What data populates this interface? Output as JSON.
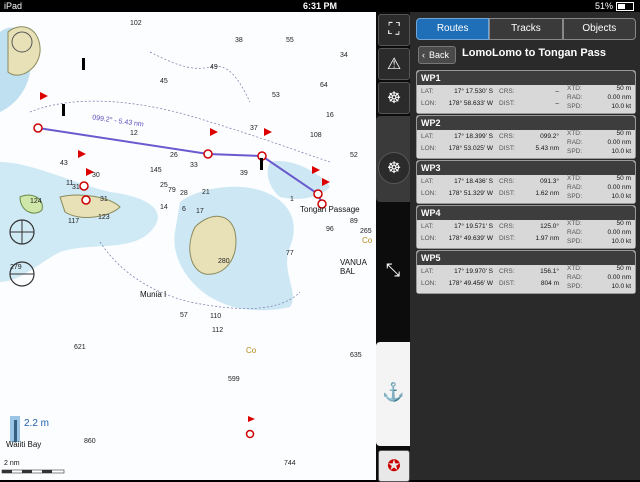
{
  "status": {
    "device": "iPad",
    "time": "6:31 PM",
    "battery": "51%"
  },
  "tabs": [
    {
      "label": "Routes",
      "active": true
    },
    {
      "label": "Tracks",
      "active": false
    },
    {
      "label": "Objects",
      "active": false
    }
  ],
  "back_label": "Back",
  "route_title": "LomoLomo to Tongan Pass",
  "waypoints": [
    {
      "name": "WP1",
      "lat": "17° 17.530' S",
      "lon": "178° 58.633' W",
      "crs": "–",
      "dist": "–",
      "xtd": "50 m",
      "rad": "0.00 nm",
      "spd": "10.0 kt"
    },
    {
      "name": "WP2",
      "lat": "17° 18.399' S",
      "lon": "178° 53.025' W",
      "crs": "099.2°",
      "dist": "5.43 nm",
      "xtd": "50 m",
      "rad": "0.00 nm",
      "spd": "10.0 kt"
    },
    {
      "name": "WP3",
      "lat": "17° 18.436' S",
      "lon": "178° 51.329' W",
      "crs": "091.3°",
      "dist": "1.62 nm",
      "xtd": "50 m",
      "rad": "0.00 nm",
      "spd": "10.0 kt"
    },
    {
      "name": "WP4",
      "lat": "17° 19.571' S",
      "lon": "178° 49.639' W",
      "crs": "125.0°",
      "dist": "1.97 nm",
      "xtd": "50 m",
      "rad": "0.00 nm",
      "spd": "10.0 kt"
    },
    {
      "name": "WP5",
      "lat": "17° 19.970' S",
      "lon": "178° 49.456' W",
      "crs": "156.1°",
      "dist": "804 m",
      "xtd": "50 m",
      "rad": "0.00 nm",
      "spd": "10.0 kt"
    }
  ],
  "field_labels": {
    "lat": "LAT:",
    "lon": "LON:",
    "crs": "CRS:",
    "dist": "DIST:",
    "xtd": "XTD:",
    "rad": "RAD:",
    "spd": "SPD:"
  },
  "map": {
    "place_labels": [
      "Tongan Passage",
      "VANUA BAL",
      "Munia I",
      "Waiiti Bay"
    ],
    "leg_label": "099.2° - 5.43 nm",
    "scale": "2 nm",
    "tide_height": "2.2 m",
    "soundings": [
      "55",
      "49",
      "45",
      "53",
      "64",
      "16",
      "102",
      "38",
      "145",
      "108",
      "12",
      "25",
      "33",
      "39",
      "37",
      "52",
      "26",
      "79",
      "14",
      "30",
      "31",
      "21",
      "28",
      "6",
      "43",
      "31",
      "17",
      "117",
      "124",
      "123",
      "11",
      "96",
      "89",
      "57",
      "280",
      "265",
      "77",
      "110",
      "112",
      "279",
      "621",
      "635",
      "599",
      "860",
      "744",
      "1",
      "34"
    ],
    "co_labels": [
      "Co",
      "Co"
    ]
  }
}
